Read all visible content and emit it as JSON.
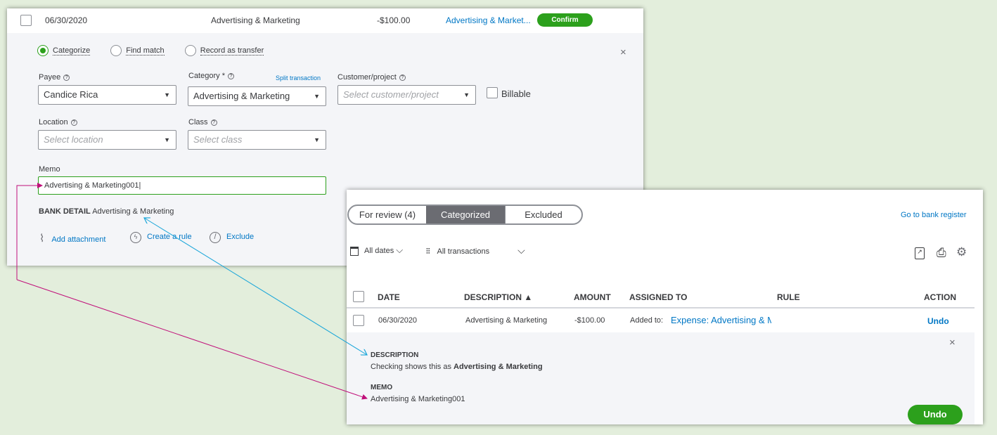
{
  "top_panel": {
    "row": {
      "date": "06/30/2020",
      "description": "Advertising & Marketing",
      "amount": "-$100.00",
      "category_link": "Advertising & Market...",
      "confirm": "Confirm"
    },
    "radios": [
      {
        "label": "Categorize",
        "selected": true
      },
      {
        "label": "Find match",
        "selected": false
      },
      {
        "label": "Record as transfer",
        "selected": false
      }
    ],
    "close": "×",
    "payee": {
      "label": "Payee",
      "value": "Candice Rica"
    },
    "category": {
      "label": "Category *",
      "value": "Advertising & Marketing",
      "split": "Split transaction"
    },
    "customer": {
      "label": "Customer/project",
      "placeholder": "Select customer/project"
    },
    "billable": "Billable",
    "location": {
      "label": "Location",
      "placeholder": "Select location"
    },
    "class": {
      "label": "Class",
      "placeholder": "Select class"
    },
    "memo": {
      "label": "Memo",
      "value": "Advertising & Marketing001"
    },
    "bank_detail": {
      "label": "BANK DETAIL",
      "value": "Advertising & Marketing"
    },
    "actions": {
      "attachment": "Add attachment",
      "rule": "Create a rule",
      "exclude": "Exclude"
    }
  },
  "bottom_panel": {
    "tabs": [
      "For review (4)",
      "Categorized",
      "Excluded"
    ],
    "active_tab": "Categorized",
    "bank_register": "Go to bank register",
    "filters": {
      "dates": "All dates",
      "transactions": "All transactions"
    },
    "headers": {
      "date": "DATE",
      "description": "DESCRIPTION ▲",
      "amount": "AMOUNT",
      "assigned": "ASSIGNED TO",
      "rule": "RULE",
      "action": "ACTION"
    },
    "row": {
      "date": "06/30/2020",
      "description": "Advertising & Marketing",
      "amount": "-$100.00",
      "added_to": "Added to:",
      "expense": "Expense: Advertising & M",
      "action": "Undo"
    },
    "detail": {
      "desc_label": "DESCRIPTION",
      "desc_prefix": "Checking shows this as",
      "desc_value": "Advertising & Marketing",
      "memo_label": "MEMO",
      "memo_value": "Advertising & Marketing001",
      "undo": "Undo",
      "close": "×"
    }
  },
  "colors": {
    "green": "#2ca01c",
    "link": "#0077c5",
    "arrow_pink": "#c0107a",
    "arrow_blue": "#1aa6d9"
  }
}
